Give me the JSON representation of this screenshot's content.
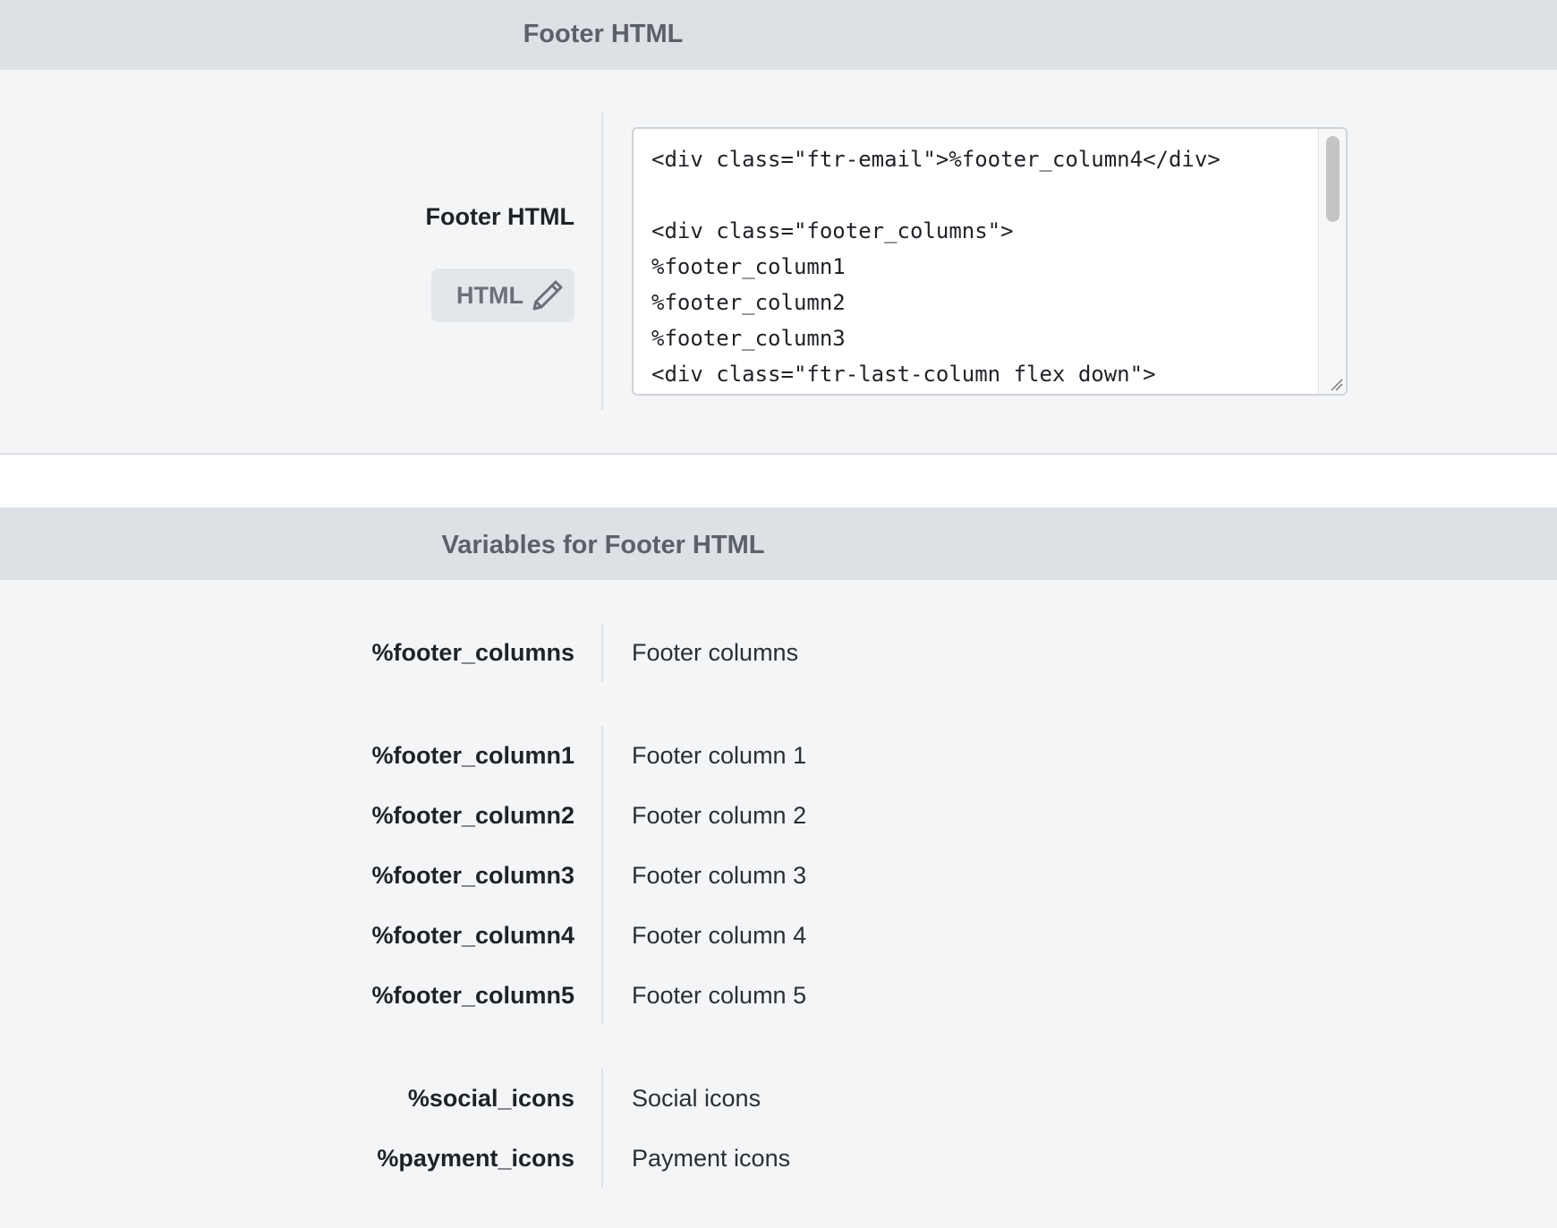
{
  "footer_section": {
    "header_title": "Footer HTML",
    "field_label": "Footer HTML",
    "html_button_label": "HTML",
    "html_button_icon": "pencil-icon",
    "editor_value": "<div class=\"ftr-email\">%footer_column4</div>\n\n<div class=\"footer_columns\">\n%footer_column1\n%footer_column2\n%footer_column3\n<div class=\"ftr-last-column flex down\">"
  },
  "variables_section": {
    "header_title": "Variables for Footer HTML",
    "groups": [
      [
        {
          "name": "%footer_columns",
          "description": "Footer columns"
        }
      ],
      [
        {
          "name": "%footer_column1",
          "description": "Footer column 1"
        },
        {
          "name": "%footer_column2",
          "description": "Footer column 2"
        },
        {
          "name": "%footer_column3",
          "description": "Footer column 3"
        },
        {
          "name": "%footer_column4",
          "description": "Footer column 4"
        },
        {
          "name": "%footer_column5",
          "description": "Footer column 5"
        }
      ],
      [
        {
          "name": "%social_icons",
          "description": "Social icons"
        },
        {
          "name": "%payment_icons",
          "description": "Payment icons"
        }
      ]
    ]
  }
}
